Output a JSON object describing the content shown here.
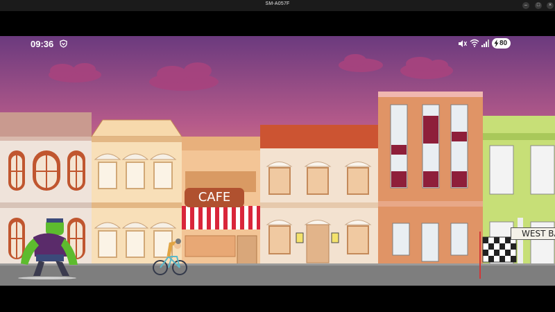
{
  "window": {
    "title": "SM-A057F",
    "controls": [
      "minimize",
      "maximize",
      "close"
    ]
  },
  "statusbar": {
    "time": "09:36",
    "battery_level": "80",
    "icons": [
      "vpn-shield-icon",
      "mute-icon",
      "wifi-icon",
      "signal-icon",
      "battery-charging-icon"
    ]
  },
  "scene": {
    "cafe_sign": "CAFE",
    "shop_sign": "WEST BA",
    "characters": [
      "green-ogre-chaser",
      "cyclist-player"
    ],
    "finish": "checkered-flag",
    "colors": {
      "sky_top": "#6a3a7c",
      "sky_bottom": "#f4b56a",
      "road": "#7e7e7e",
      "cafe_awning": "#d9263b",
      "ogre_skin": "#5dbb2e"
    }
  }
}
